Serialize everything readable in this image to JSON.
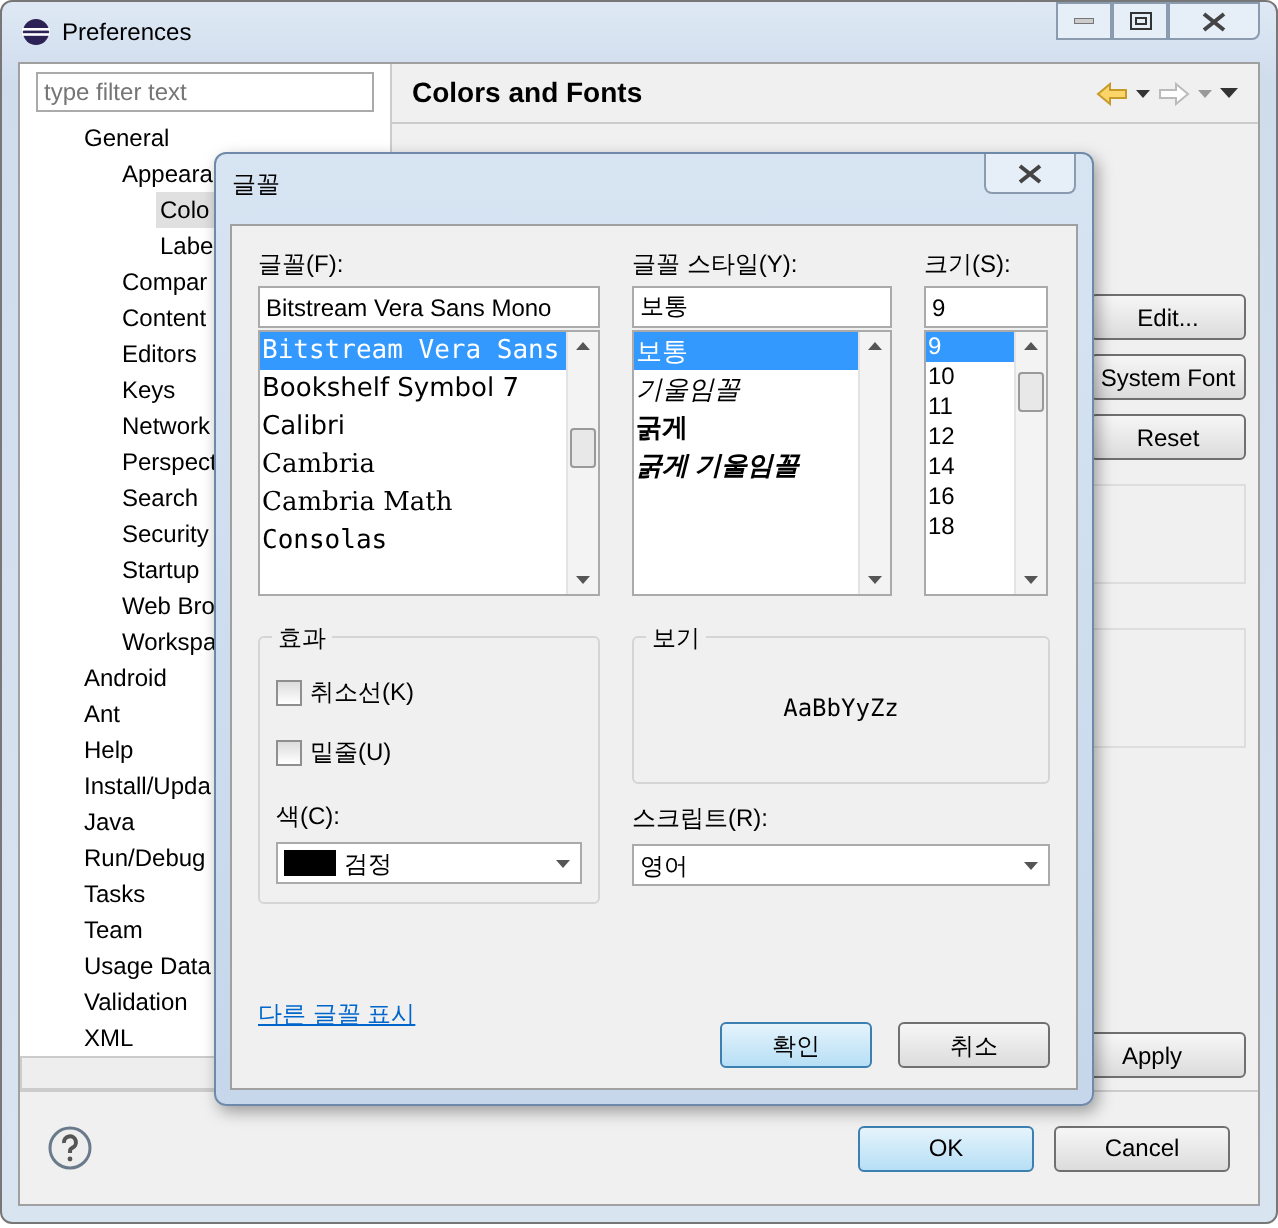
{
  "window": {
    "title": "Preferences"
  },
  "filter": {
    "placeholder": "type filter text"
  },
  "tree": [
    {
      "label": "General",
      "selected": false,
      "children": [
        {
          "label": "Appeara",
          "selected": false,
          "children": [
            {
              "label": "Colo",
              "selected": true
            },
            {
              "label": "Labe",
              "selected": false
            }
          ]
        },
        {
          "label": "Compar",
          "selected": false
        },
        {
          "label": "Content",
          "selected": false
        },
        {
          "label": "Editors",
          "selected": false
        },
        {
          "label": "Keys",
          "selected": false
        },
        {
          "label": "Network",
          "selected": false
        },
        {
          "label": "Perspect",
          "selected": false
        },
        {
          "label": "Search",
          "selected": false
        },
        {
          "label": "Security",
          "selected": false
        },
        {
          "label": "Startup",
          "selected": false
        },
        {
          "label": "Web Bro",
          "selected": false
        },
        {
          "label": "Workspa",
          "selected": false
        }
      ]
    },
    {
      "label": "Android",
      "selected": false
    },
    {
      "label": "Ant",
      "selected": false
    },
    {
      "label": "Help",
      "selected": false
    },
    {
      "label": "Install/Upda",
      "selected": false
    },
    {
      "label": "Java",
      "selected": false
    },
    {
      "label": "Run/Debug",
      "selected": false
    },
    {
      "label": "Tasks",
      "selected": false
    },
    {
      "label": "Team",
      "selected": false
    },
    {
      "label": "Usage Data",
      "selected": false
    },
    {
      "label": "Validation",
      "selected": false
    },
    {
      "label": "XML",
      "selected": false
    }
  ],
  "page": {
    "title": "Colors and Fonts",
    "side_buttons": [
      "Edit...",
      "System Font",
      "Reset"
    ],
    "apply": "Apply"
  },
  "footer": {
    "buttons": [
      {
        "label": "OK",
        "default": true
      },
      {
        "label": "Cancel",
        "default": false
      }
    ]
  },
  "font_dialog": {
    "title": "글꼴",
    "font": {
      "label": "글꼴(F):",
      "value": "Bitstream Vera Sans Mono",
      "items": [
        {
          "label": "Bitstream Vera Sans",
          "kind": "mono",
          "selected": true
        },
        {
          "label": "Bookshelf Symbol 7",
          "kind": "sans",
          "selected": false
        },
        {
          "label": "Calibri",
          "kind": "sans",
          "selected": false
        },
        {
          "label": "Cambria",
          "kind": "serif",
          "selected": false
        },
        {
          "label": "Cambria Math",
          "kind": "serif",
          "selected": false
        },
        {
          "label": "Consolas",
          "kind": "mono",
          "selected": false
        }
      ]
    },
    "style": {
      "label": "글꼴 스타일(Y):",
      "value": "보통",
      "items": [
        {
          "label": "보통",
          "kind": "regular",
          "selected": true
        },
        {
          "label": "기울임꼴",
          "kind": "italic",
          "selected": false
        },
        {
          "label": "굵게",
          "kind": "bold",
          "selected": false
        },
        {
          "label": "굵게 기울임꼴",
          "kind": "bold-italic",
          "selected": false
        }
      ]
    },
    "size": {
      "label": "크기(S):",
      "value": "9",
      "items": [
        {
          "label": "9",
          "selected": true
        },
        {
          "label": "10",
          "selected": false
        },
        {
          "label": "11",
          "selected": false
        },
        {
          "label": "12",
          "selected": false
        },
        {
          "label": "14",
          "selected": false
        },
        {
          "label": "16",
          "selected": false
        },
        {
          "label": "18",
          "selected": false
        }
      ]
    },
    "effects": {
      "title": "효과",
      "options": [
        {
          "label": "취소선(K)",
          "checked": false
        },
        {
          "label": "밑줄(U)",
          "checked": false
        }
      ],
      "color_label": "색(C):",
      "color_value": "검정",
      "color": "#000000"
    },
    "preview": {
      "title": "보기",
      "sample": "AaBbYyZz"
    },
    "script": {
      "label": "스크립트(R):",
      "value": "영어"
    },
    "link": "다른 글꼴 표시",
    "buttons": [
      {
        "label": "확인",
        "default": true
      },
      {
        "label": "취소",
        "default": false
      }
    ]
  }
}
